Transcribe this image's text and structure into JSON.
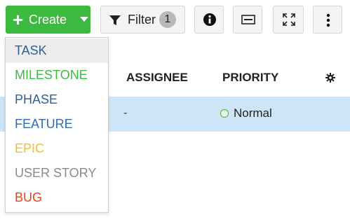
{
  "toolbar": {
    "create_label": "Create",
    "filter_label": "Filter",
    "filter_count": "1",
    "create_color": "#3cb93f",
    "icons": [
      "plus-icon",
      "chevron-down-icon",
      "filter-icon",
      "info-icon",
      "panel-icon",
      "expand-icon",
      "more-vertical-icon"
    ]
  },
  "table": {
    "columns": [
      "ASSIGNEE",
      "PRIORITY"
    ],
    "settings_icon": "gear-icon",
    "rows": [
      {
        "assignee": "-",
        "priority": "Normal",
        "selected": true
      }
    ]
  },
  "create_menu": {
    "items": [
      {
        "label": "TASK",
        "color": "#2f5f9b"
      },
      {
        "label": "MILESTONE",
        "color": "#3cb93f"
      },
      {
        "label": "PHASE",
        "color": "#2f5f9b"
      },
      {
        "label": "FEATURE",
        "color": "#2f6db5"
      },
      {
        "label": "EPIC",
        "color": "#f2be2c"
      },
      {
        "label": "USER STORY",
        "color": "#8a8a8a"
      },
      {
        "label": "BUG",
        "color": "#e8411b"
      }
    ],
    "hovered": "TASK"
  }
}
